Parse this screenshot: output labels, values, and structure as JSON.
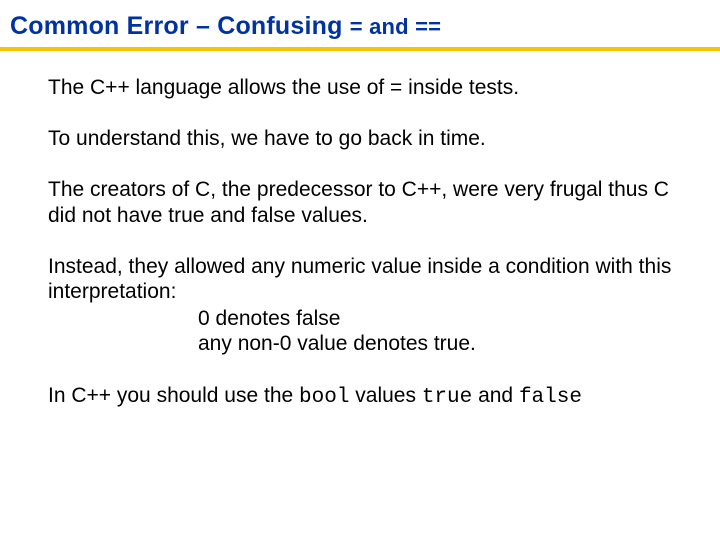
{
  "title": {
    "main": "Common Error – Confusing ",
    "sub": "= and =="
  },
  "p1": "The C++ language allows the use of = inside tests.",
  "p2": "To understand this, we have to go back in time.",
  "p3": "The creators of C, the predecessor to C++, were very frugal thus C did not have true and false values.",
  "p4_lead": "Instead, they allowed any numeric value inside a condition with this interpretation:",
  "p4_l1": "0 denotes false",
  "p4_l2": "any non-0 value denotes true.",
  "p5_a": "In C++ you should use the ",
  "p5_b": "bool",
  "p5_c": " values ",
  "p5_d": "true",
  "p5_e": " and ",
  "p5_f": "false"
}
